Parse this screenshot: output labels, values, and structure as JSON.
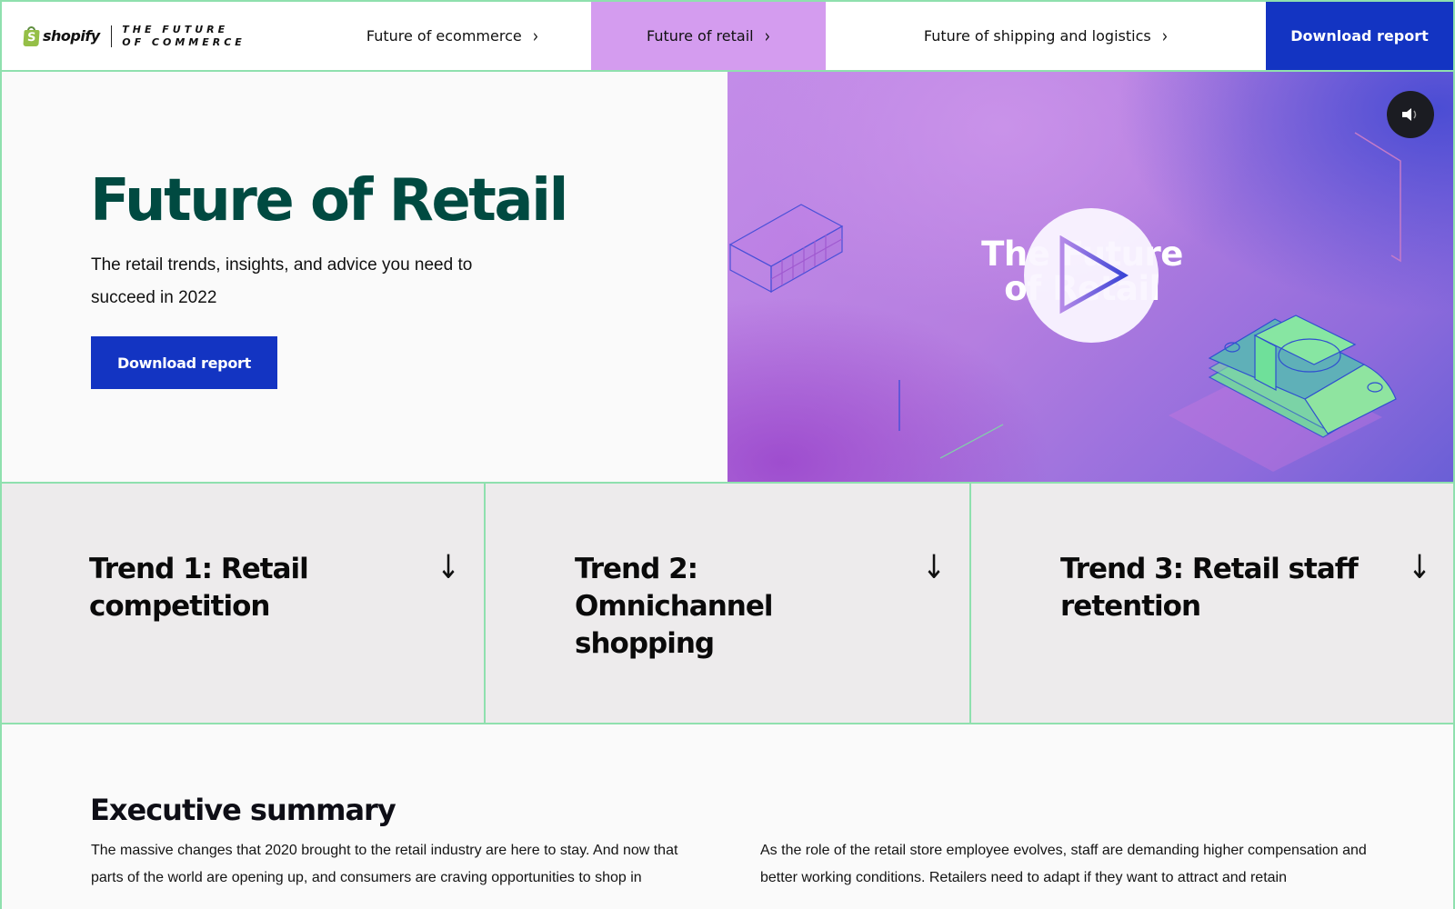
{
  "header": {
    "brand": "shopify",
    "tagline_line1": "THE FUTURE",
    "tagline_line2": "OF COMMERCE",
    "nav": [
      {
        "label": "Future of ecommerce",
        "icon": "chevron-right-icon",
        "active": false
      },
      {
        "label": "Future of retail",
        "icon": "chevron-right-icon",
        "active": true
      },
      {
        "label": "Future of shipping and logistics",
        "icon": "chevron-right-icon",
        "active": false
      }
    ],
    "download_label": "Download report"
  },
  "hero": {
    "title": "Future of Retail",
    "subtitle": "The retail trends, insights, and advice you need to succeed in 2022",
    "button_label": "Download report",
    "video": {
      "title_line1": "The Future",
      "title_line2": "of Retail",
      "play_icon": "play-icon",
      "mute_icon": "speaker-icon"
    }
  },
  "trends": [
    {
      "title": "Trend 1: Retail competition",
      "icon": "arrow-down-icon"
    },
    {
      "title": "Trend 2: Omnichannel shopping",
      "icon": "arrow-down-icon"
    },
    {
      "title": "Trend 3: Retail staff retention",
      "icon": "arrow-down-icon"
    }
  ],
  "executive_summary": {
    "title": "Executive summary",
    "left_paragraph": "The massive changes that 2020 brought to the retail industry are here to stay. And now that parts of the world are opening up, and consumers are craving opportunities to shop in",
    "right_paragraph": "As the role of the retail store employee evolves, staff are demanding higher compensation and better working conditions. Retailers need to adapt if they want to attract and retain"
  },
  "colors": {
    "accent_green_border": "#8fe0ae",
    "active_nav": "#d49cef",
    "primary_blue": "#1334c2",
    "title_green": "#004a41",
    "trend_bg": "#edebec"
  },
  "chevron": "›",
  "arrow_down": "↓"
}
